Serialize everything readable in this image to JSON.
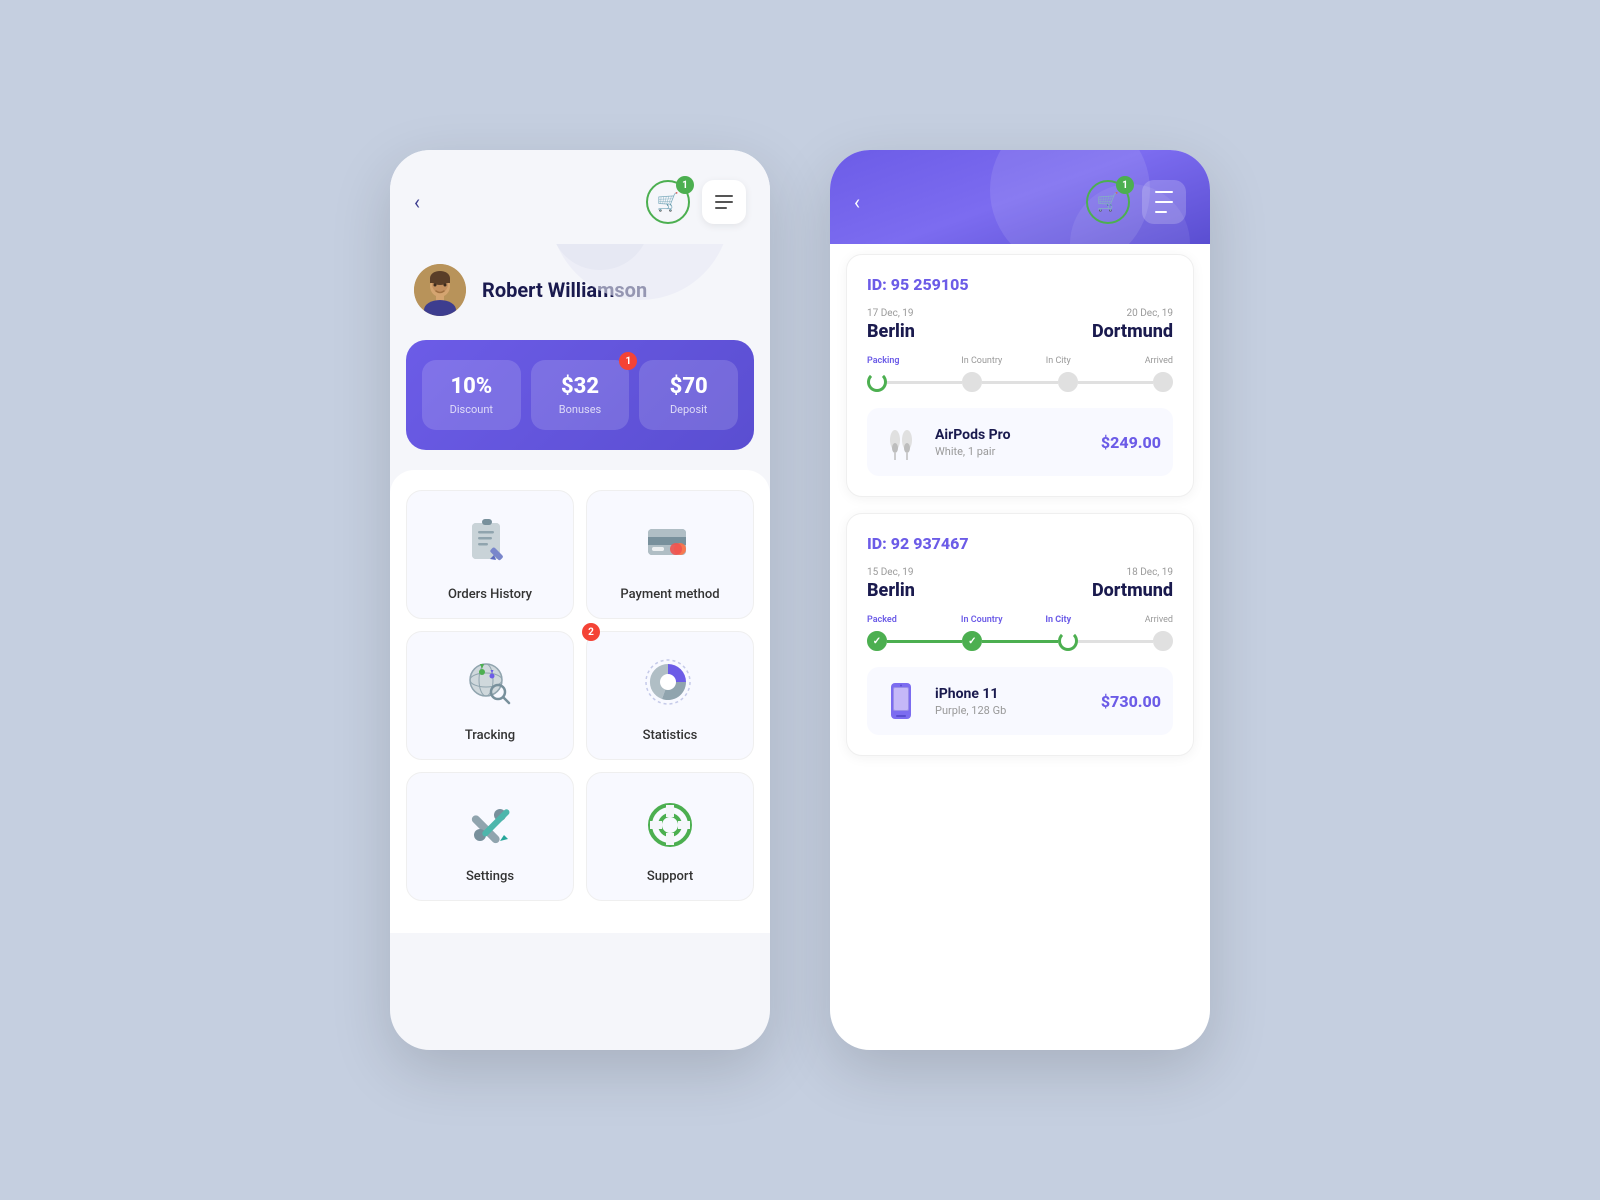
{
  "background": "#c5cfe0",
  "left_phone": {
    "header": {
      "back_label": "‹",
      "cart_badge": "1",
      "menu_lines": 3
    },
    "user": {
      "name": "Robert Williamson",
      "avatar_emoji": "👤"
    },
    "stats": {
      "discount": {
        "value": "10%",
        "label": "Discount"
      },
      "bonuses": {
        "value": "$32",
        "label": "Bonuses",
        "badge": "1"
      },
      "deposit": {
        "value": "$70",
        "label": "Deposit"
      }
    },
    "menu_items": [
      {
        "id": "orders-history",
        "label": "Orders History",
        "icon": "📋"
      },
      {
        "id": "payment-method",
        "label": "Payment method",
        "icon": "💳"
      },
      {
        "id": "tracking",
        "label": "Tracking",
        "icon": "🌐",
        "badge": "2"
      },
      {
        "id": "statistics",
        "label": "Statistics",
        "icon": "📊"
      },
      {
        "id": "settings",
        "label": "Settings",
        "icon": "🔧"
      },
      {
        "id": "support",
        "label": "Support",
        "icon": "🔄"
      }
    ]
  },
  "right_phone": {
    "header": {
      "back_label": "‹",
      "cart_badge": "1"
    },
    "orders": [
      {
        "id": "ID: 95 259105",
        "from_date": "17 Dec, 19",
        "from_city": "Berlin",
        "to_date": "20 Dec, 19",
        "to_city": "Dortmund",
        "tracking_labels": [
          "Packing",
          "In Country",
          "In City",
          "Arrived"
        ],
        "tracking_active_step": 0,
        "product_name": "AirPods Pro",
        "product_desc": "White, 1 pair",
        "product_price": "$249.00",
        "product_emoji": "🎧"
      },
      {
        "id": "ID: 92 937467",
        "from_date": "15 Dec, 19",
        "from_city": "Berlin",
        "to_date": "18 Dec, 19",
        "to_city": "Dortmund",
        "tracking_labels": [
          "Packed",
          "In Country",
          "In City",
          "Arrived"
        ],
        "tracking_active_step": 2,
        "product_name": "iPhone 11",
        "product_desc": "Purple, 128 Gb",
        "product_price": "$730.00",
        "product_emoji": "📱"
      }
    ]
  }
}
